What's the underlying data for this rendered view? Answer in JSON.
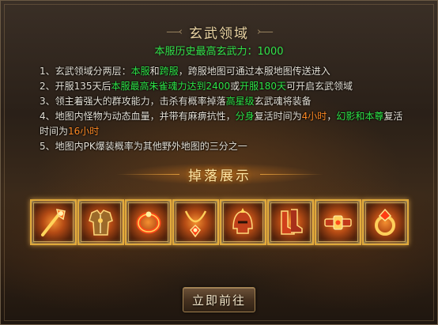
{
  "dialog": {
    "title": "玄武领域",
    "subtitle": "本服历史最高玄武力：1000"
  },
  "rules": [
    [
      {
        "t": "1、玄武领域分两层：",
        "c": ""
      },
      {
        "t": "本服",
        "c": "g"
      },
      {
        "t": "和",
        "c": ""
      },
      {
        "t": "跨服",
        "c": "g"
      },
      {
        "t": "，跨服地图可通过本服地图传送进入",
        "c": ""
      }
    ],
    [
      {
        "t": "2、开服135天后",
        "c": ""
      },
      {
        "t": "本服最高朱雀魂力达到2400",
        "c": "g"
      },
      {
        "t": "或",
        "c": ""
      },
      {
        "t": "开服180天",
        "c": "g"
      },
      {
        "t": "可开启玄武领域",
        "c": ""
      }
    ],
    [
      {
        "t": "3、领主着强大的群攻能力，击杀有概率掉落",
        "c": ""
      },
      {
        "t": "高星级",
        "c": "g"
      },
      {
        "t": "玄武魂将装备",
        "c": ""
      }
    ],
    [
      {
        "t": "4、地图内怪物为动态血量，并带有麻痹抗性，",
        "c": ""
      },
      {
        "t": "分身",
        "c": "g"
      },
      {
        "t": "复活时间为",
        "c": ""
      },
      {
        "t": "4小时",
        "c": "o"
      },
      {
        "t": "，",
        "c": ""
      },
      {
        "t": "幻影和本尊",
        "c": "g"
      },
      {
        "t": "复活时间为",
        "c": ""
      },
      {
        "t": "16小时",
        "c": "o"
      }
    ],
    [
      {
        "t": "5、地图内PK爆装概率为其他野外地图的三分之一",
        "c": ""
      }
    ]
  ],
  "drops": {
    "title": "掉落展示",
    "items": [
      {
        "icon": "scepter-icon"
      },
      {
        "icon": "armor-icon"
      },
      {
        "icon": "bracelet-icon"
      },
      {
        "icon": "necklace-icon"
      },
      {
        "icon": "helmet-icon"
      },
      {
        "icon": "boots-icon"
      },
      {
        "icon": "belt-icon"
      },
      {
        "icon": "ring-icon"
      }
    ]
  },
  "actions": {
    "go_label": "立即前往"
  },
  "colors": {
    "highlight_green": "#2fe548",
    "highlight_orange": "#ff8a24",
    "title_gold": "#e9d3a2"
  }
}
